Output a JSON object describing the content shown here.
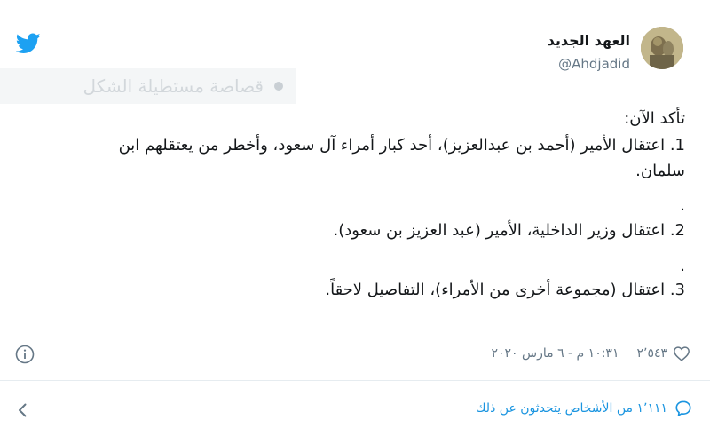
{
  "author": {
    "display_name": "العهد الجديد",
    "handle": "@Ahdjadid"
  },
  "overlay": {
    "label": "قصاصة مستطيلة الشكل"
  },
  "tweet": {
    "intro": "تأكد الآن:",
    "item1_a": "1. اعتقال الأمير (أحمد بن عبدالعزيز)، أحد كبار أمراء آل سعود، وأخطر من يعتقلهم ابن",
    "item1_b": "سلمان.",
    "sep1": ".",
    "item2": "2. اعتقال وزير الداخلية، الأمير (عبد العزيز بن سعود).",
    "sep2": ".",
    "item3": "3. اعتقال (مجموعة أخرى من الأمراء)، التفاصيل لاحقاً."
  },
  "meta": {
    "likes": "٢٬٥٤٣",
    "timestamp": "١٠:٣١ م - ٦ مارس ٢٠٢٠"
  },
  "footer": {
    "people_talking": "١٬١١١ من الأشخاص يتحدثون عن ذلك"
  },
  "colors": {
    "brand_blue": "#1da1f2",
    "link_blue": "#1b95e0",
    "muted_text": "#657786"
  },
  "icons": {
    "brand": "twitter-bird-icon",
    "info": "info-icon",
    "like": "heart-icon",
    "replies": "speech-bubble-icon",
    "back": "chevron-left-icon"
  }
}
